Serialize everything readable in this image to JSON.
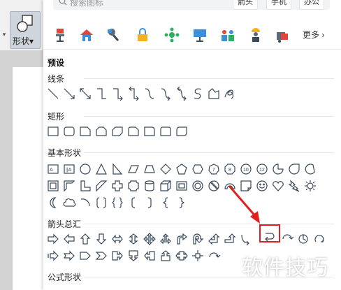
{
  "toolbar": {
    "shape_button_label": "形状",
    "dropdown_glyph": "▾"
  },
  "search": {
    "placeholder": "搜索图标"
  },
  "chips": [
    "箭头",
    "手机",
    "办公"
  ],
  "icon_row": {
    "icons": [
      "chair-icon",
      "house-icon",
      "pin-icon",
      "lock-icon",
      "network-icon",
      "presentation-icon",
      "people-icon",
      "worker-icon",
      "delivery-box-icon"
    ],
    "more_label": "更多",
    "more_glyph": "›"
  },
  "panel": {
    "preset_title": "预设"
  },
  "sections": {
    "lines": "线条",
    "rectangles": "矩形",
    "basic_shapes": "基本形状",
    "block_arrows": "箭头总汇",
    "equation_shapes": "公式形状"
  },
  "shape_labels": {
    "num7": "7",
    "num8": "8",
    "num10": "10",
    "num12": "12"
  },
  "watermark": "软件技巧",
  "colors": {
    "highlight": "#e02020",
    "annotation_arrow": "#e02020",
    "shape_stroke": "#3a4a5a"
  }
}
